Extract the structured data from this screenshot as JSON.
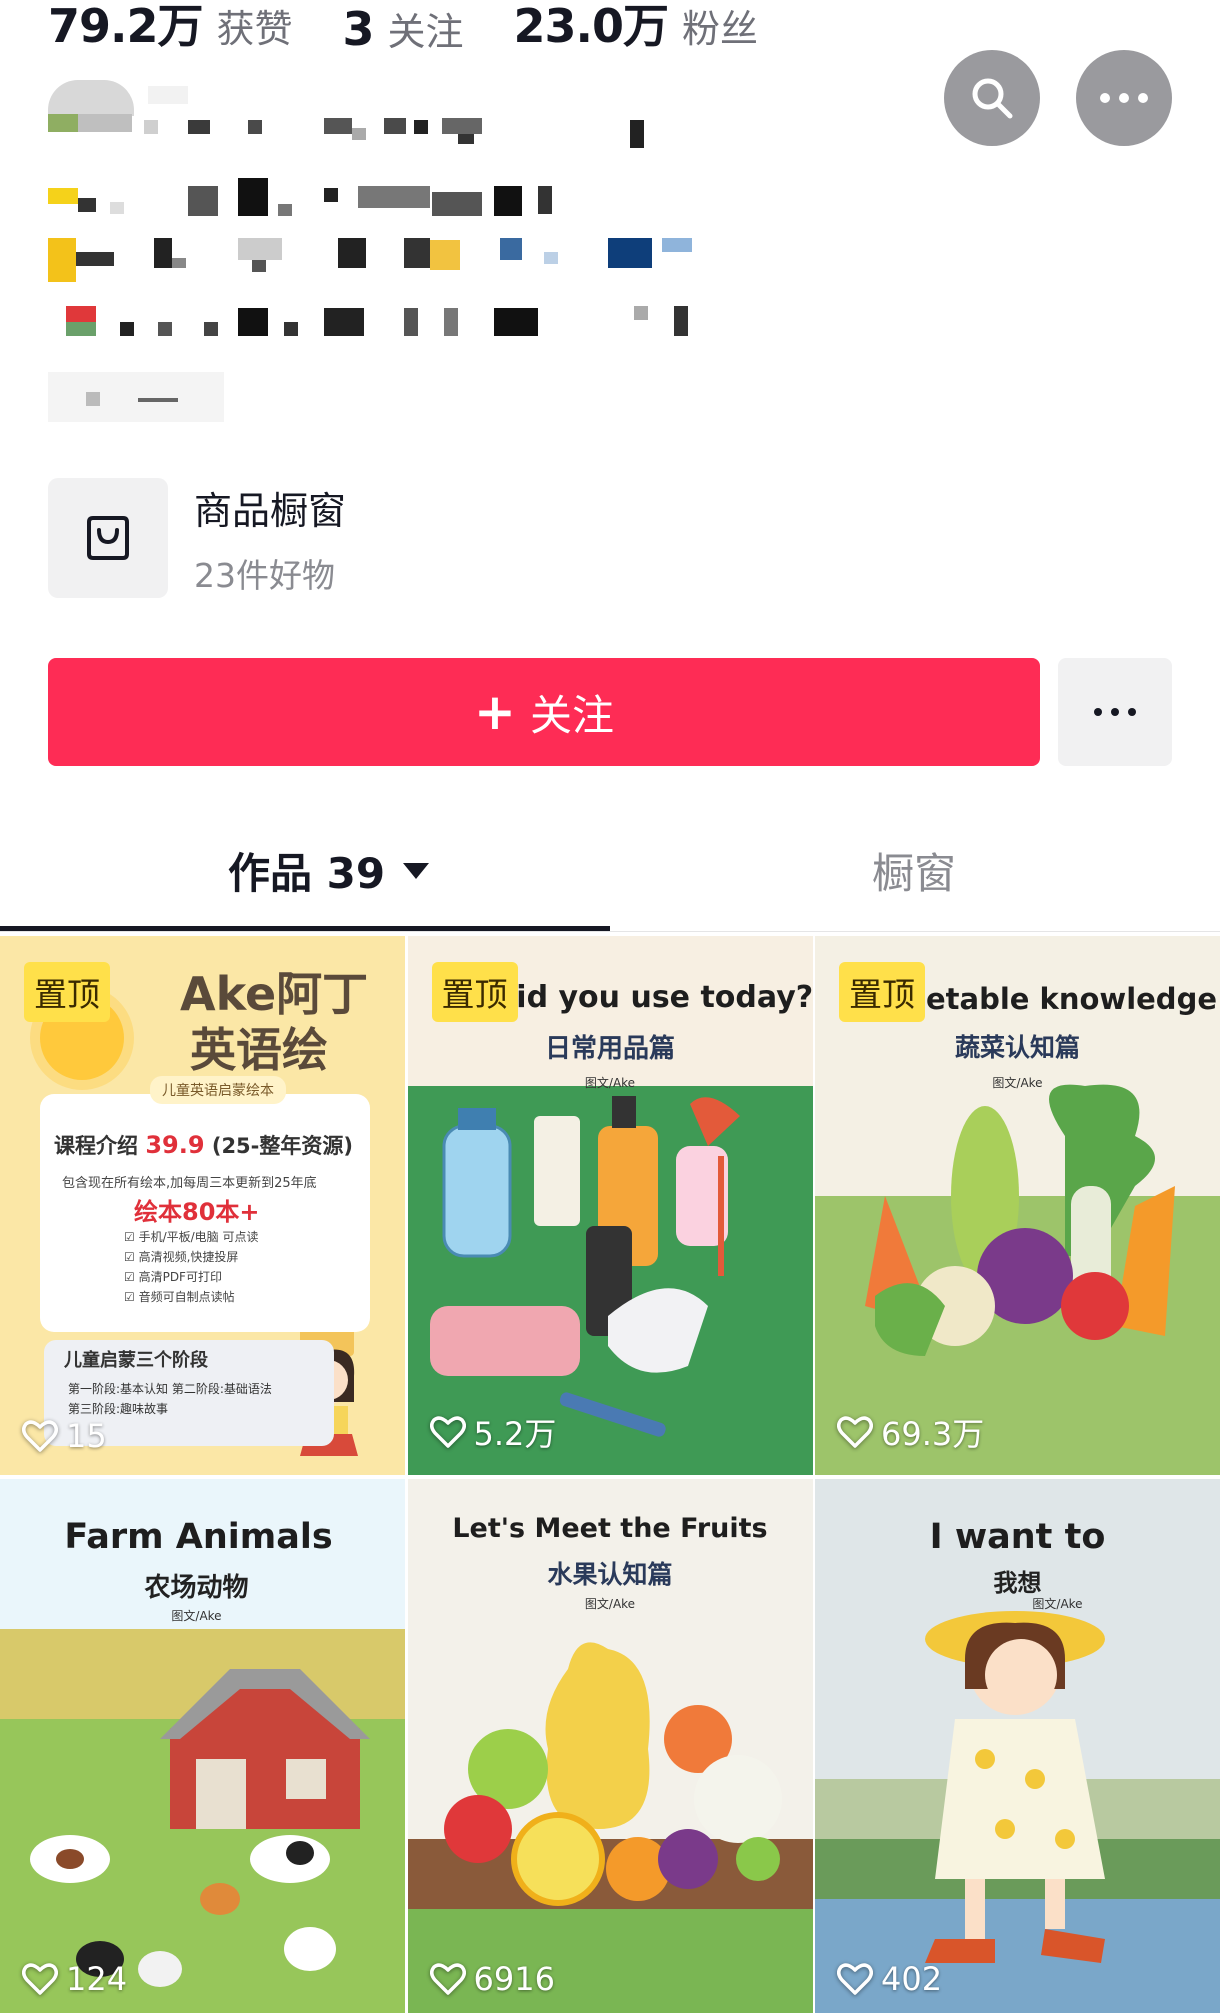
{
  "stats": [
    {
      "value": "79.2万",
      "label": "获赞"
    },
    {
      "value": "3",
      "label": "关注"
    },
    {
      "value": "23.0万",
      "label": "粉丝"
    }
  ],
  "top_buttons": {
    "search_icon": "search-icon",
    "more_icon": "more-icon"
  },
  "shop": {
    "title": "商品橱窗",
    "subtitle": "23件好物",
    "icon": "shopping-bag-icon"
  },
  "follow": {
    "label": "关注",
    "plus": "+"
  },
  "tabs": {
    "works_label": "作品 39",
    "window_label": "橱窗"
  },
  "colors": {
    "follow_red": "#fe2c55",
    "pin_yellow": "#ffe04a",
    "tab_active": "#161823",
    "tab_inactive": "#8a8b91"
  },
  "videos": [
    {
      "pinned": true,
      "pin_label": "置顶",
      "likes": "15",
      "brand": "Ake阿丁",
      "brand_line2": "英语绘",
      "tag": "儿童英语启蒙绘本",
      "course_prefix": "课程介绍",
      "course_price": "39.9",
      "course_suffix": "(25-整年资源)",
      "desc": "包含现在所有绘本,加每周三本更新到25年底",
      "big": "绘本80本+",
      "features": [
        "手机/平板/电脑 可点读",
        "高清视频,快捷投屏",
        "高清PDF可打印",
        "音频可自制点读帖"
      ],
      "stage_title": "儿童启蒙三个阶段",
      "stage_line1": "第一阶段:基本认知   第二阶段:基础语法",
      "stage_line2": "第三阶段:趣味故事"
    },
    {
      "pinned": true,
      "pin_label": "置顶",
      "likes": "5.2万",
      "title": "did you use today?",
      "subtitle": "日常用品篇",
      "credit": "图文/Ake"
    },
    {
      "pinned": true,
      "pin_label": "置顶",
      "likes": "69.3万",
      "title": "etable knowledge",
      "subtitle": "蔬菜认知篇",
      "credit": "图文/Ake"
    },
    {
      "pinned": false,
      "likes": "124",
      "title": "Farm Animals",
      "subtitle": "农场动物",
      "credit": "图文/Ake"
    },
    {
      "pinned": false,
      "likes": "6916",
      "title": "Let's Meet the Fruits",
      "subtitle": "水果认知篇",
      "credit": "图文/Ake"
    },
    {
      "pinned": false,
      "likes": "402",
      "title": "I want to",
      "subtitle": "我想",
      "credit": "图文/Ake"
    }
  ]
}
